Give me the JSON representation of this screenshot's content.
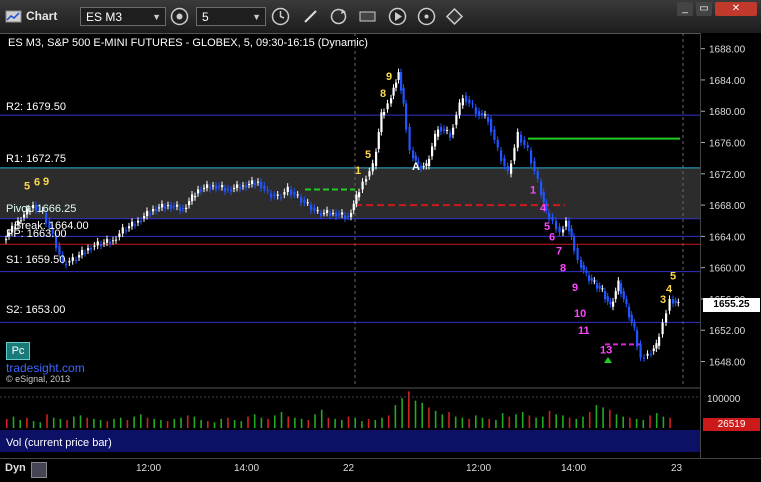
{
  "toolbar": {
    "app_label": "Chart",
    "symbol_value": "ES M3",
    "interval_value": "5"
  },
  "chart_title": "ES M3, S&P 500 E-MINI FUTURES - GLOBEX, 5, 09:30-16:15 (Dynamic)",
  "pivots": {
    "r2": "R2: 1679.50",
    "r1": "R1: 1672.75",
    "pivot": "Pivot: 1666.25",
    "pp": "PP: 1663.00",
    "break": "Break: 1664.00",
    "s1": "S1: 1659.50",
    "s2": "S2: 1653.00"
  },
  "branding": {
    "pc_label": "Pc",
    "site": "tradesight.com",
    "copyright": "© eSignal, 2013"
  },
  "volume_panel": {
    "label": "Vol (current price bar)",
    "axis_label": "100000",
    "current_value": "26519"
  },
  "current_price_label": "1655.25",
  "footer": {
    "mode_label": "Dyn"
  },
  "colors": {
    "up_candle": "#ffffff",
    "down_candle": "#2255ff",
    "pivot_line": "#3333cc",
    "accent_red": "#cc1a1a",
    "volume_up": "#22aa22",
    "volume_down": "#cc2222",
    "current_price_bg": "#cc1a1a"
  },
  "chart_data": {
    "type": "candlestick",
    "title": "ES M3, S&P 500 E-MINI FUTURES - GLOBEX, 5, 09:30-16:15 (Dynamic)",
    "ylim": [
      1645,
      1690
    ],
    "y_ticks": [
      1648.0,
      1652.0,
      1656.0,
      1660.0,
      1664.0,
      1668.0,
      1672.0,
      1676.0,
      1680.0,
      1684.0,
      1688.0
    ],
    "x_ticks": [
      "12:00",
      "14:00",
      "22",
      "12:00",
      "14:00",
      "23"
    ],
    "levels": [
      {
        "label": "R2",
        "value": 1679.5
      },
      {
        "label": "R1",
        "value": 1672.75
      },
      {
        "label": "Pivot",
        "value": 1666.25
      },
      {
        "label": "PP",
        "value": 1663.0
      },
      {
        "label": "Break",
        "value": 1664.0
      },
      {
        "label": "S1",
        "value": 1659.5
      },
      {
        "label": "S2",
        "value": 1653.0
      }
    ],
    "close_path": [
      [
        5,
        1663.5
      ],
      [
        20,
        1666
      ],
      [
        35,
        1668
      ],
      [
        45,
        1667
      ],
      [
        55,
        1664
      ],
      [
        65,
        1660.5
      ],
      [
        75,
        1661
      ],
      [
        90,
        1662.5
      ],
      [
        100,
        1663
      ],
      [
        115,
        1663.5
      ],
      [
        125,
        1664.8
      ],
      [
        140,
        1666
      ],
      [
        155,
        1667.5
      ],
      [
        170,
        1668
      ],
      [
        185,
        1667.5
      ],
      [
        200,
        1670
      ],
      [
        215,
        1670.5
      ],
      [
        230,
        1670
      ],
      [
        245,
        1670.5
      ],
      [
        260,
        1671
      ],
      [
        270,
        1669.5
      ],
      [
        280,
        1669
      ],
      [
        290,
        1670
      ],
      [
        300,
        1669
      ],
      [
        310,
        1668
      ],
      [
        320,
        1667
      ],
      [
        335,
        1667
      ],
      [
        350,
        1666.5
      ],
      [
        358,
        1669
      ],
      [
        365,
        1671
      ],
      [
        375,
        1673
      ],
      [
        383,
        1679.5
      ],
      [
        390,
        1681
      ],
      [
        395,
        1683
      ],
      [
        400,
        1685
      ],
      [
        405,
        1681
      ],
      [
        412,
        1675
      ],
      [
        420,
        1673
      ],
      [
        428,
        1673
      ],
      [
        440,
        1678
      ],
      [
        452,
        1677
      ],
      [
        465,
        1682
      ],
      [
        478,
        1680
      ],
      [
        490,
        1679
      ],
      [
        500,
        1675
      ],
      [
        510,
        1672
      ],
      [
        520,
        1677
      ],
      [
        530,
        1675
      ],
      [
        540,
        1671
      ],
      [
        548,
        1667
      ],
      [
        555,
        1666
      ],
      [
        562,
        1664.5
      ],
      [
        568,
        1666
      ],
      [
        573,
        1664
      ],
      [
        580,
        1661
      ],
      [
        588,
        1659
      ],
      [
        596,
        1658
      ],
      [
        604,
        1657
      ],
      [
        612,
        1655
      ],
      [
        620,
        1658
      ],
      [
        628,
        1655
      ],
      [
        636,
        1652
      ],
      [
        643,
        1648.5
      ],
      [
        650,
        1649
      ],
      [
        658,
        1650
      ],
      [
        665,
        1653
      ],
      [
        672,
        1656
      ],
      [
        680,
        1655.25
      ]
    ],
    "volume": [
      8,
      10,
      7,
      9,
      6,
      5,
      12,
      9,
      8,
      7,
      10,
      11,
      9,
      8,
      7,
      6,
      8,
      9,
      7,
      10,
      12,
      9,
      8,
      7,
      6,
      8,
      9,
      11,
      10,
      7,
      6,
      5,
      8,
      9,
      7,
      6,
      10,
      12,
      9,
      8,
      11,
      14,
      10,
      9,
      8,
      7,
      12,
      16,
      9,
      8,
      7,
      10,
      9,
      6,
      8,
      7,
      9,
      11,
      20,
      26,
      32,
      24,
      22,
      18,
      15,
      12,
      14,
      10,
      9,
      8,
      11,
      9,
      8,
      7,
      13,
      10,
      12,
      14,
      11,
      9,
      10,
      15,
      12,
      11,
      9,
      8,
      10,
      14,
      20,
      18,
      16,
      12,
      10,
      9,
      8,
      7,
      11,
      13,
      10,
      9
    ]
  }
}
